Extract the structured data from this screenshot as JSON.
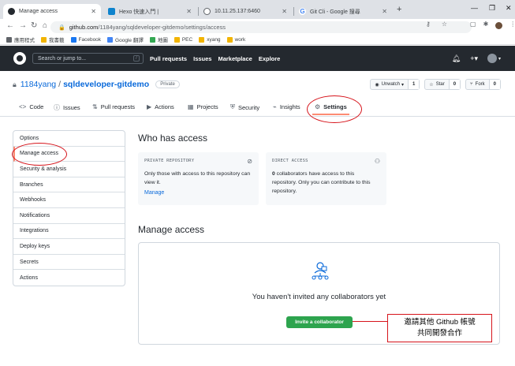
{
  "browser": {
    "tabs": [
      {
        "title": "Manage access",
        "favicon": "github-icon",
        "active": true
      },
      {
        "title": "Hexo 快速入門 |",
        "favicon": "hexo-icon",
        "active": false
      },
      {
        "title": "10.11.25.137:6460",
        "favicon": "globe-icon",
        "active": false
      },
      {
        "title": "Git Cli - Google 搜尋",
        "favicon": "google-icon",
        "active": false
      }
    ],
    "new_tab_label": "+",
    "url_host": "github.com",
    "url_path": "/1184yang/sqldeveloper-gitdemo/settings/access",
    "bookmarks": [
      {
        "label": "應用程式",
        "color": "#5f6368"
      },
      {
        "label": "我書籤",
        "color": "#f2b400"
      },
      {
        "label": "Facebook",
        "color": "#1877f2"
      },
      {
        "label": "Google 翻譯",
        "color": "#4285f4"
      },
      {
        "label": "地圖",
        "color": "#34a853"
      },
      {
        "label": "PEC",
        "color": "#f2b400"
      },
      {
        "label": "xyang",
        "color": "#f2b400"
      },
      {
        "label": "work",
        "color": "#f2b400"
      }
    ]
  },
  "github_header": {
    "search_placeholder": "Search or jump to...",
    "search_shortcut": "/",
    "nav": [
      "Pull requests",
      "Issues",
      "Marketplace",
      "Explore"
    ]
  },
  "repo": {
    "owner": "1184yang",
    "separator": "/",
    "name": "sqldeveloper-gitdemo",
    "visibility": "Private",
    "watch_label": "Unwatch",
    "watch_count": "1",
    "star_label": "Star",
    "star_count": "0",
    "fork_label": "Fork",
    "fork_count": "0"
  },
  "repo_tabs": [
    {
      "label": "Code",
      "icon": "<>",
      "selected": false
    },
    {
      "label": "Issues",
      "icon": "ⓘ",
      "selected": false
    },
    {
      "label": "Pull requests",
      "icon": "⇅",
      "selected": false
    },
    {
      "label": "Actions",
      "icon": "▶",
      "selected": false
    },
    {
      "label": "Projects",
      "icon": "▦",
      "selected": false
    },
    {
      "label": "Security",
      "icon": "⛨",
      "selected": false
    },
    {
      "label": "Insights",
      "icon": "⌁",
      "selected": false
    },
    {
      "label": "Settings",
      "icon": "⚙",
      "selected": true
    }
  ],
  "sidebar": {
    "items": [
      {
        "label": "Options",
        "selected": false
      },
      {
        "label": "Manage access",
        "selected": true
      },
      {
        "label": "Security & analysis",
        "selected": false
      },
      {
        "label": "Branches",
        "selected": false
      },
      {
        "label": "Webhooks",
        "selected": false
      },
      {
        "label": "Notifications",
        "selected": false
      },
      {
        "label": "Integrations",
        "selected": false
      },
      {
        "label": "Deploy keys",
        "selected": false
      },
      {
        "label": "Secrets",
        "selected": false
      },
      {
        "label": "Actions",
        "selected": false
      }
    ]
  },
  "who_has_access": {
    "heading": "Who has access",
    "private_card": {
      "caption": "PRIVATE REPOSITORY",
      "text": "Only those with access to this repository can view it.",
      "link": "Manage"
    },
    "direct_card": {
      "caption": "DIRECT ACCESS",
      "count": "0",
      "text": "collaborators have access to this repository. Only you can contribute to this repository."
    }
  },
  "manage_access": {
    "heading": "Manage access",
    "empty_message": "You haven't invited any collaborators yet",
    "invite_button": "Invite a collaborator"
  },
  "annotation": {
    "line1": "邀請其他 Github 帳號",
    "line2": "共同開發合作",
    "color": "#d6141b"
  }
}
